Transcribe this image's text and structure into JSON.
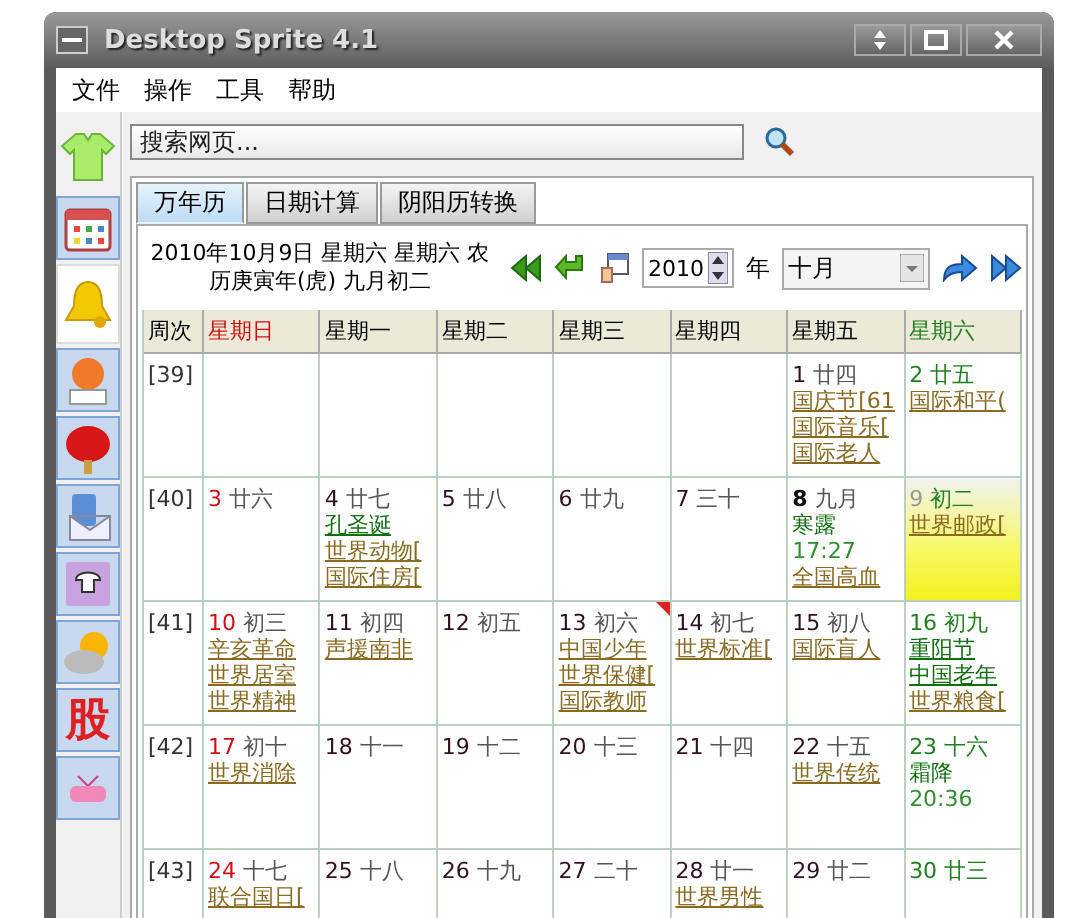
{
  "window": {
    "title": "Desktop Sprite 4.1"
  },
  "menu": [
    "文件",
    "操作",
    "工具",
    "帮助"
  ],
  "sidebar": [
    {
      "kind": "shirt",
      "selected": false
    },
    {
      "kind": "calendar",
      "selected": false
    },
    {
      "kind": "bell",
      "selected": true
    },
    {
      "kind": "person",
      "selected": false
    },
    {
      "kind": "lantern",
      "selected": false
    },
    {
      "kind": "mail",
      "selected": false
    },
    {
      "kind": "phone",
      "selected": false
    },
    {
      "kind": "weather",
      "selected": false
    },
    {
      "kind": "glyph",
      "label": "股",
      "selected": false
    },
    {
      "kind": "tv",
      "selected": false
    }
  ],
  "search": {
    "placeholder": "搜索网页..."
  },
  "tabs": [
    {
      "label": "万年历",
      "selected": true
    },
    {
      "label": "日期计算",
      "selected": false
    },
    {
      "label": "阴阳历转换",
      "selected": false
    }
  ],
  "date_text": "2010年10月9日 星期六 星期六 农历庚寅年(虎) 九月初二",
  "year": "2010",
  "year_unit": "年",
  "month": "十月",
  "columns": [
    "周次",
    "星期日",
    "星期一",
    "星期二",
    "星期三",
    "星期四",
    "星期五",
    "星期六"
  ],
  "weeks": [
    {
      "label": "[39]",
      "days": [
        {
          "day": "1",
          "lunar": "廿四",
          "today": false,
          "bold": false,
          "note": false,
          "events": [
            {
              "kind": "festival",
              "text": "国庆节[61"
            },
            {
              "kind": "festival",
              "text": "国际音乐["
            },
            {
              "kind": "festival",
              "text": "国际老人"
            }
          ]
        },
        {
          "day": "2",
          "lunar": "廿五",
          "today": false,
          "bold": false,
          "note": false,
          "events": [
            {
              "kind": "festival",
              "text": "国际和平("
            }
          ]
        }
      ]
    },
    {
      "label": "[40]",
      "days": [
        {
          "day": "3",
          "lunar": "廿六",
          "today": false,
          "bold": false,
          "note": false
        },
        {
          "day": "4",
          "lunar": "廿七",
          "today": false,
          "bold": false,
          "note": false,
          "events": [
            {
              "kind": "holiday",
              "text": "孔圣诞"
            },
            {
              "kind": "festival",
              "text": "世界动物["
            },
            {
              "kind": "festival",
              "text": "国际住房["
            }
          ]
        },
        {
          "day": "5",
          "lunar": "廿八",
          "today": false,
          "bold": false,
          "note": false
        },
        {
          "day": "6",
          "lunar": "廿九",
          "today": false,
          "bold": false,
          "note": false
        },
        {
          "day": "7",
          "lunar": "三十",
          "today": false,
          "bold": false,
          "note": false
        },
        {
          "day": "8",
          "lunar": "九月",
          "today": false,
          "bold": true,
          "note": false,
          "events": [
            {
              "kind": "term",
              "text": "寒露"
            },
            {
              "kind": "time",
              "text": "17:27"
            },
            {
              "kind": "festival",
              "text": "全国高血"
            }
          ]
        },
        {
          "day": "9",
          "lunar": "初二",
          "today": true,
          "bold": false,
          "note": false,
          "events": [
            {
              "kind": "festival",
              "text": "世界邮政["
            }
          ]
        }
      ]
    },
    {
      "label": "[41]",
      "days": [
        {
          "day": "10",
          "lunar": "初三",
          "today": false,
          "bold": false,
          "note": false,
          "events": [
            {
              "kind": "festival",
              "text": "辛亥革命"
            },
            {
              "kind": "festival",
              "text": "世界居室"
            },
            {
              "kind": "festival",
              "text": "世界精神"
            }
          ]
        },
        {
          "day": "11",
          "lunar": "初四",
          "today": false,
          "bold": false,
          "note": false,
          "events": [
            {
              "kind": "festival",
              "text": "声援南非"
            }
          ]
        },
        {
          "day": "12",
          "lunar": "初五",
          "today": false,
          "bold": false,
          "note": false
        },
        {
          "day": "13",
          "lunar": "初六",
          "today": false,
          "bold": false,
          "note": true,
          "events": [
            {
              "kind": "festival",
              "text": "中国少年"
            },
            {
              "kind": "festival",
              "text": "世界保健["
            },
            {
              "kind": "festival",
              "text": "国际教师"
            }
          ]
        },
        {
          "day": "14",
          "lunar": "初七",
          "today": false,
          "bold": false,
          "note": false,
          "events": [
            {
              "kind": "festival",
              "text": "世界标准["
            }
          ]
        },
        {
          "day": "15",
          "lunar": "初八",
          "today": false,
          "bold": false,
          "note": false,
          "events": [
            {
              "kind": "festival",
              "text": "国际盲人"
            }
          ]
        },
        {
          "day": "16",
          "lunar": "初九",
          "today": false,
          "bold": false,
          "note": false,
          "events": [
            {
              "kind": "holiday",
              "text": "重阳节"
            },
            {
              "kind": "holiday",
              "text": "中国老年"
            },
            {
              "kind": "festival",
              "text": "世界粮食["
            }
          ]
        }
      ]
    },
    {
      "label": "[42]",
      "days": [
        {
          "day": "17",
          "lunar": "初十",
          "today": false,
          "bold": false,
          "note": false,
          "events": [
            {
              "kind": "festival",
              "text": "世界消除"
            }
          ]
        },
        {
          "day": "18",
          "lunar": "十一",
          "today": false,
          "bold": false,
          "note": false
        },
        {
          "day": "19",
          "lunar": "十二",
          "today": false,
          "bold": false,
          "note": false
        },
        {
          "day": "20",
          "lunar": "十三",
          "today": false,
          "bold": false,
          "note": false
        },
        {
          "day": "21",
          "lunar": "十四",
          "today": false,
          "bold": false,
          "note": false
        },
        {
          "day": "22",
          "lunar": "十五",
          "today": false,
          "bold": false,
          "note": false,
          "events": [
            {
              "kind": "festival",
              "text": "世界传统"
            }
          ]
        },
        {
          "day": "23",
          "lunar": "十六",
          "today": false,
          "bold": false,
          "note": false,
          "events": [
            {
              "kind": "term",
              "text": "霜降"
            },
            {
              "kind": "time",
              "text": "20:36"
            }
          ]
        }
      ]
    },
    {
      "label": "[43]",
      "days": [
        {
          "day": "24",
          "lunar": "十七",
          "today": false,
          "bold": false,
          "note": false,
          "events": [
            {
              "kind": "festival",
              "text": "联合国日["
            }
          ]
        },
        {
          "day": "25",
          "lunar": "十八",
          "today": false,
          "bold": false,
          "note": false
        },
        {
          "day": "26",
          "lunar": "十九",
          "today": false,
          "bold": false,
          "note": false
        },
        {
          "day": "27",
          "lunar": "二十",
          "today": false,
          "bold": false,
          "note": false
        },
        {
          "day": "28",
          "lunar": "廿一",
          "today": false,
          "bold": false,
          "note": false,
          "events": [
            {
              "kind": "festival",
              "text": "世界男性"
            }
          ]
        },
        {
          "day": "29",
          "lunar": "廿二",
          "today": false,
          "bold": false,
          "note": false
        },
        {
          "day": "30",
          "lunar": "廿三",
          "today": false,
          "bold": false,
          "note": false
        }
      ]
    }
  ]
}
